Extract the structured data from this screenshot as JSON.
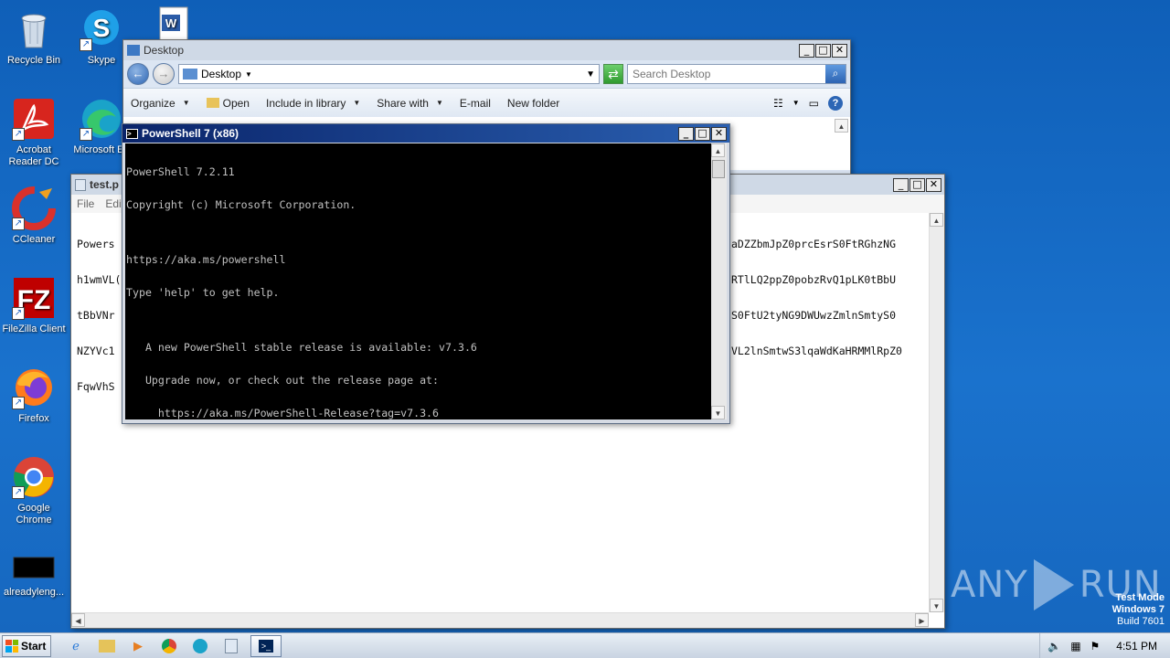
{
  "desktop": {
    "icons": [
      {
        "label": "Recycle Bin"
      },
      {
        "label": "Skype"
      },
      {
        "label": "Acrobat Reader DC"
      },
      {
        "label": "Microsoft Ed"
      },
      {
        "label": "CCleaner"
      },
      {
        "label": "FileZilla Client"
      },
      {
        "label": "Firefox"
      },
      {
        "label": "Google Chrome"
      },
      {
        "label": "alreadyleng..."
      }
    ]
  },
  "explorer": {
    "title": "Desktop",
    "address": "Desktop",
    "search_placeholder": "Search Desktop",
    "commands": {
      "organize": "Organize",
      "open": "Open",
      "include": "Include in library",
      "share": "Share with",
      "email": "E-mail",
      "new_folder": "New folder"
    }
  },
  "notepad": {
    "title": "test.p",
    "menu": {
      "file": "File",
      "edit": "Edit"
    },
    "left_lines": [
      "Powers",
      "h1wmVL(",
      "tBbVNr",
      "NZYVc1",
      "FqwVhS"
    ],
    "right_lines": [
      "aDZZbmJpZ0prcEsrS0FtRGhzNG",
      "RTlLQ2ppZ0pobzRvQ1pLK0tBbU",
      "S0FtU2tyNG9DWUwzZmlnSmtyS0",
      "VL2lnSmtwS3lqaWdKaHRMMlRpZ0"
    ]
  },
  "powershell": {
    "title": "PowerShell 7 (x86)",
    "lines": [
      "PowerShell 7.2.11",
      "Copyright (c) Microsoft Corporation.",
      "",
      "https://aka.ms/powershell",
      "Type 'help' to get help.",
      "",
      "   A new PowerShell stable release is available: v7.3.6",
      "   Upgrade now, or check out the release page at:",
      "     https://aka.ms/PowerShell-Release?tag=v7.3.6"
    ]
  },
  "watermark": {
    "left": "ANY",
    "right": "RUN"
  },
  "system": {
    "test_mode": "Test Mode",
    "os": "Windows 7",
    "build": "Build 7601"
  },
  "taskbar": {
    "start": "Start",
    "clock": "4:51 PM"
  }
}
